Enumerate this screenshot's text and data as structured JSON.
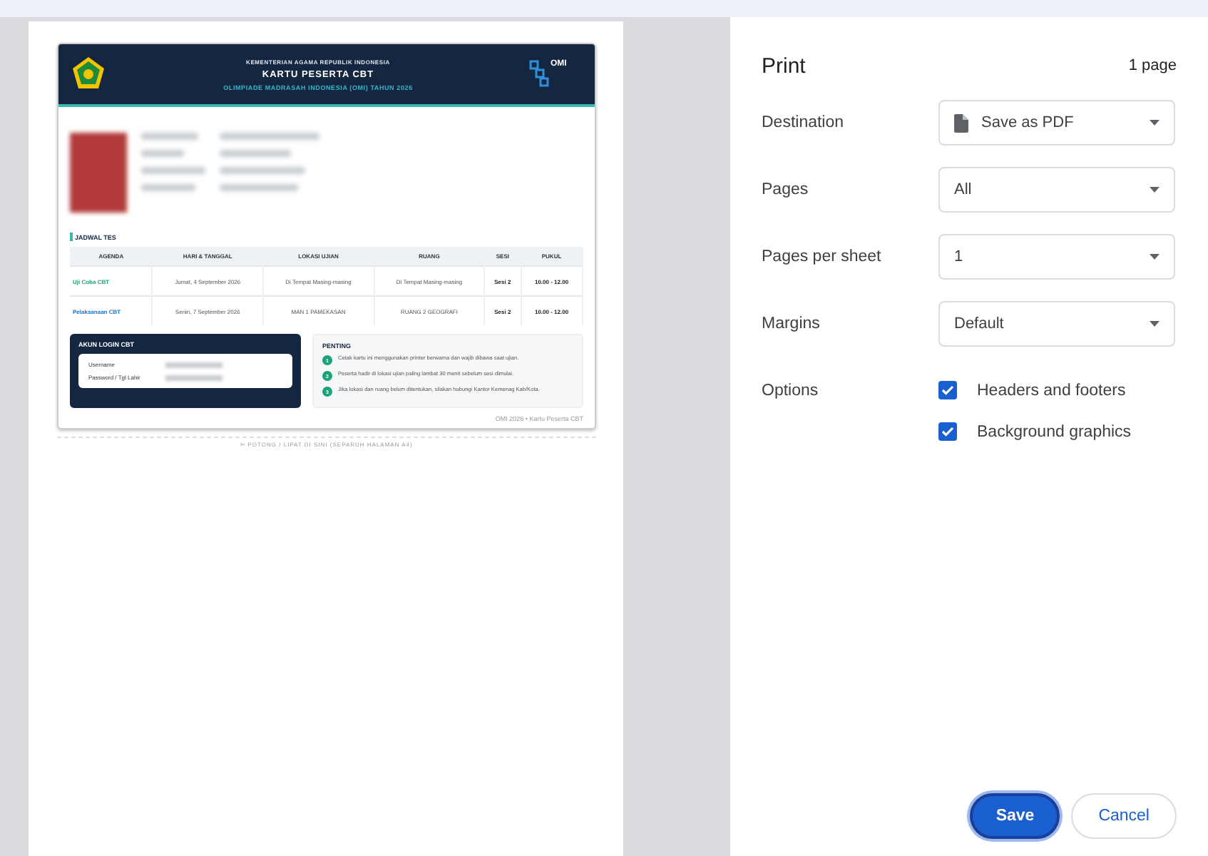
{
  "preview": {
    "card": {
      "header": {
        "ministry": "KEMENTERIAN AGAMA REPUBLIK INDONESIA",
        "title": "KARTU PESERTA CBT",
        "subtitle": "OLIMPIADE MADRASAH INDONESIA (OMI) TAHUN 2026",
        "logo_text": "OMI"
      },
      "schedule": {
        "heading": "JADWAL TES",
        "columns": [
          "AGENDA",
          "HARI & TANGGAL",
          "LOKASI UJIAN",
          "RUANG",
          "SESI",
          "PUKUL"
        ],
        "rows": [
          {
            "color": "#12a37a",
            "cells": [
              "Uji Coba CBT",
              "Jumat, 4 September 2026",
              "Di Tempat Masing-masing",
              "Di Tempat Masing-masing",
              "Sesi 2",
              "10.00 - 12.00"
            ]
          },
          {
            "color": "#1a73c8",
            "cells": [
              "Pelaksanaan CBT",
              "Senin, 7 September 2026",
              "MAN 1 PAMEKASAN",
              "RUANG 2 GEOGRAFI",
              "Sesi 2",
              "10.00 - 12.00"
            ]
          }
        ]
      },
      "login": {
        "heading": "AKUN LOGIN CBT",
        "fields": [
          "Username",
          "Password / Tgl Lahir"
        ]
      },
      "notes": {
        "heading": "PENTING",
        "items": [
          {
            "number": "1",
            "text": "Cetak kartu ini menggunakan printer berwarna dan wajib dibawa saat ujian."
          },
          {
            "number": "2",
            "text": "Peserta hadir di lokasi ujian paling lambat 30 menit sebelum sesi dimulai."
          },
          {
            "number": "3",
            "text": "Jika lokasi dan ruang belum ditentukan, silakan hubungi Kantor Kemenag Kab/Kota."
          }
        ]
      },
      "footer": "OMI 2026 • Kartu Peserta CBT"
    },
    "cut_icon": "✄",
    "cut_line": "POTONG / LIPAT DI SINI (SEPARUH HALAMAN A4)"
  },
  "print": {
    "title": "Print",
    "page_count": "1 page",
    "settings": [
      {
        "label": "Destination",
        "kind": "select",
        "value": "Save as PDF",
        "icon": true
      },
      {
        "label": "Pages",
        "kind": "select",
        "value": "All"
      },
      {
        "label": "Pages per sheet",
        "kind": "select",
        "value": "1"
      },
      {
        "label": "Margins",
        "kind": "select",
        "value": "Default"
      },
      {
        "label": "Options",
        "kind": "checkboxes",
        "options": [
          {
            "label": "Headers and footers",
            "checked": true
          },
          {
            "label": "Background graphics",
            "checked": true
          }
        ]
      }
    ],
    "buttons": [
      {
        "label": "Save",
        "kind": "primary"
      },
      {
        "label": "Cancel",
        "kind": "secondary"
      }
    ]
  }
}
